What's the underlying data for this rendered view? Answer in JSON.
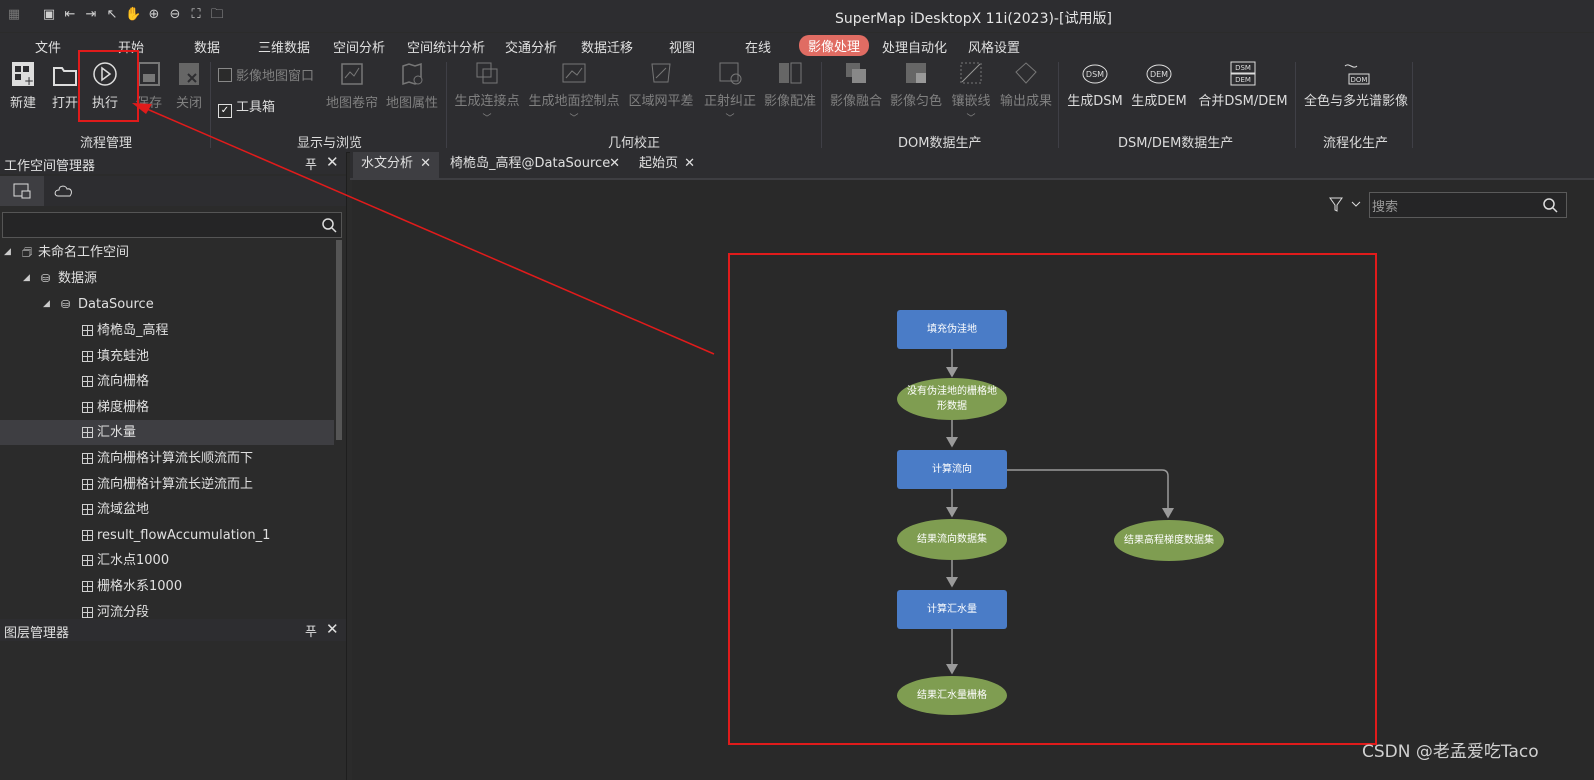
{
  "titlebar": {
    "title": "SuperMap iDesktopX 11i(2023)-[试用版]"
  },
  "menu": [
    "文件",
    "开始",
    "数据",
    "三维数据",
    "空间分析",
    "空间统计分析",
    "交通分析",
    "数据迁移",
    "视图",
    "在线",
    "影像处理",
    "处理自动化",
    "风格设置"
  ],
  "menu_active": "影像处理",
  "ribbon": {
    "btn_new": "新建",
    "btn_open": "打开",
    "btn_run": "执行",
    "btn_save": "保存",
    "btn_close": "关闭",
    "chk_image_map": "影像地图窗口",
    "chk_toolbox": "工具箱",
    "btn_map_roll": "地图卷帘",
    "btn_map_props": "地图属性",
    "btn_tiepoints": "生成连接点",
    "btn_gcp": "生成地面控制点",
    "btn_block": "区域网平差",
    "btn_ortho": "正射纠正",
    "btn_register": "影像配准",
    "btn_fusion": "影像融合",
    "btn_color": "影像匀色",
    "btn_seamline": "镶嵌线",
    "btn_output": "输出成果",
    "btn_dsm": "生成DSM",
    "btn_dem": "生成DEM",
    "btn_merge": "合并DSM/DEM",
    "btn_pan": "全色与多光谱影像",
    "icon_dsm": "DSM",
    "icon_dem": "DEM",
    "icon_dsm2": "DSM",
    "icon_dem2": "DEM",
    "icon_dom": "DOM",
    "group_flow": "流程管理",
    "group_display": "显示与浏览",
    "group_geo": "几何校正",
    "group_dom": "DOM数据生产",
    "group_dsm": "DSM/DEM数据生产",
    "group_flowprod": "流程化生产"
  },
  "workspace": {
    "title": "工作空间管理器",
    "root": "未命名工作空间",
    "datasources": "数据源",
    "datasource": "DataSource",
    "datasets": [
      "椅桅岛_高程",
      "填充蛙池",
      "流向栅格",
      "梯度栅格",
      "汇水量",
      "流向栅格计算流长顺流而下",
      "流向栅格计算流长逆流而上",
      "流域盆地",
      "result_flowAccumulation_1",
      "汇水点1000",
      "栅格水系1000",
      "河流分段"
    ],
    "selected_index": 4
  },
  "layers": {
    "title": "图层管理器"
  },
  "doctabs": [
    "水文分析",
    "椅桅岛_高程@DataSource",
    "起始页"
  ],
  "doctab_close": "✕",
  "search": {
    "placeholder": "搜索"
  },
  "flow": {
    "fill": "填充伪洼地",
    "no_sink_line1": "没有伪洼地的栅格地",
    "no_sink_line2": "形数据",
    "calc_dir": "计算流向",
    "result_dir": "结果流向数据集",
    "result_slope": "结果高程梯度数据集",
    "calc_acc": "计算汇水量",
    "result_acc": "结果汇水量栅格"
  },
  "watermark": "CSDN @老孟爱吃Taco",
  "colors": {
    "accent_red": "#e01b1b",
    "node_blue": "#4a7cc7",
    "node_green": "#7f9d51",
    "active_menu": "#e06c63"
  }
}
